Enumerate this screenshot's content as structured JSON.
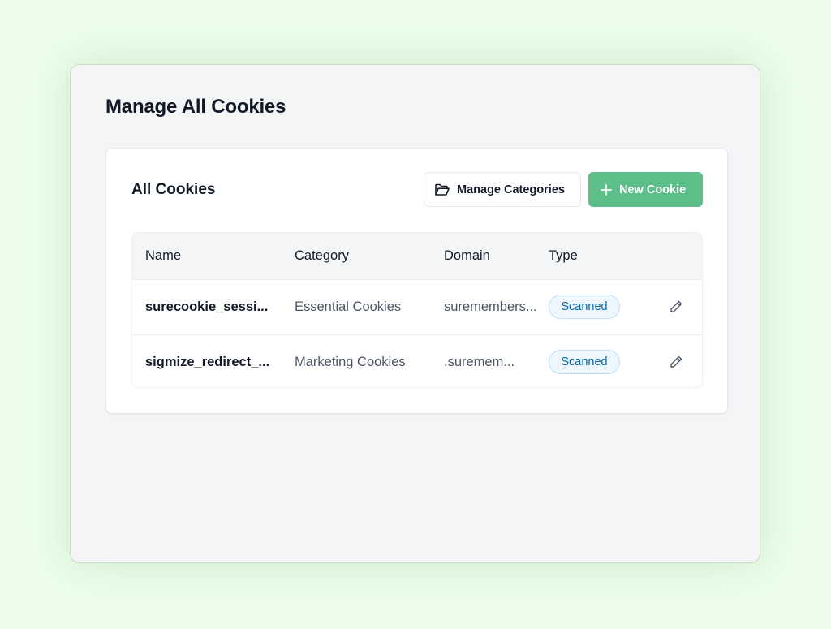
{
  "page": {
    "title": "Manage All Cookies"
  },
  "card": {
    "title": "All Cookies",
    "manage_categories_label": "Manage Categories",
    "new_cookie_label": "New Cookie"
  },
  "table": {
    "columns": [
      "Name",
      "Category",
      "Domain",
      "Type"
    ],
    "rows": [
      {
        "name": "surecookie_sessi...",
        "category": "Essential Cookies",
        "domain": "suremembers...",
        "type": "Scanned"
      },
      {
        "name": "sigmize_redirect_...",
        "category": "Marketing Cookies",
        "domain": ".suremem...",
        "type": "Scanned"
      }
    ]
  },
  "icons": {
    "manage_categories": "folder-open-icon",
    "new_cookie": "plus-icon",
    "edit": "pencil-icon"
  },
  "colors": {
    "accent": "#5cbf8a",
    "badge_text": "#0a69a5",
    "badge_bg": "#eef7fd",
    "badge_border": "#bfe0f5",
    "page_bg": "#ecfdec"
  }
}
